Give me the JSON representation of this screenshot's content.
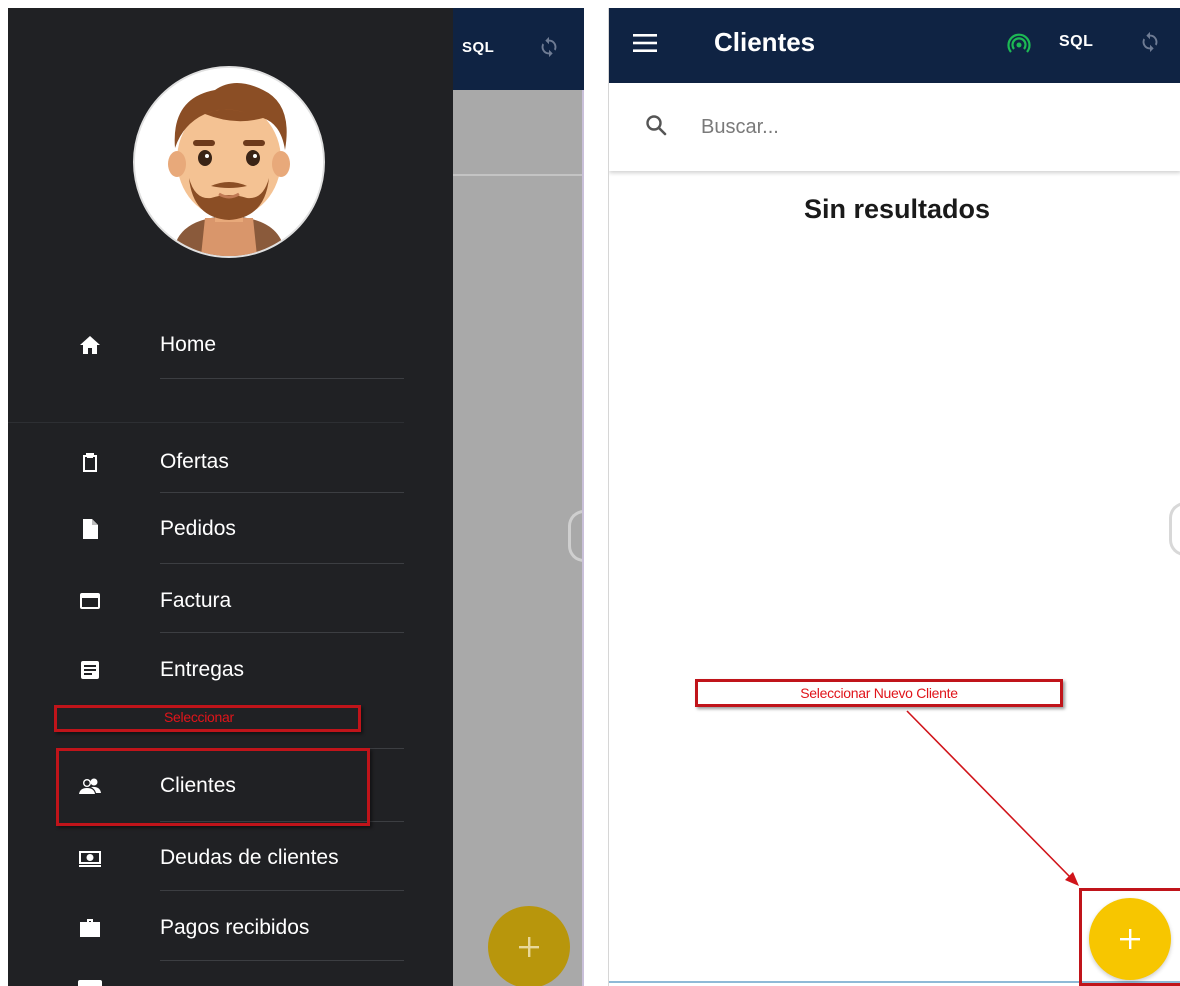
{
  "left_screen": {
    "appbar": {
      "sql_label": "SQL"
    },
    "drawer": {
      "items": [
        {
          "label": "Home",
          "icon": "home-icon"
        },
        {
          "label": "Ofertas",
          "icon": "clipboard-icon"
        },
        {
          "label": "Pedidos",
          "icon": "document-icon"
        },
        {
          "label": "Factura",
          "icon": "credit-card-icon"
        },
        {
          "label": "Entregas",
          "icon": "list-document-icon"
        },
        {
          "label": "Clientes",
          "icon": "people-icon"
        },
        {
          "label": "Deudas de clientes",
          "icon": "money-icon"
        },
        {
          "label": "Pagos recibidos",
          "icon": "briefcase-icon"
        }
      ]
    },
    "annotation_label": "Seleccionar"
  },
  "right_screen": {
    "appbar": {
      "title": "Clientes",
      "sql_label": "SQL"
    },
    "search": {
      "placeholder": "Buscar..."
    },
    "empty_message": "Sin resultados",
    "annotation_label": "Seleccionar Nuevo Cliente"
  },
  "colors": {
    "appbar": "#0f2343",
    "drawer": "#202124",
    "fab": "#f7c600",
    "annotation": "#c0141a",
    "signal": "#1db954"
  }
}
